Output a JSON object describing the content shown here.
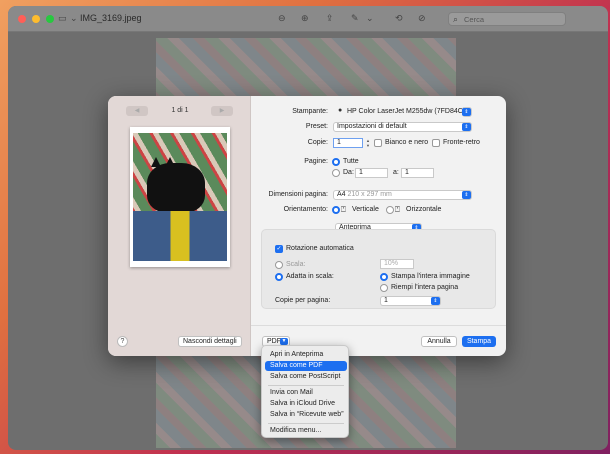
{
  "window": {
    "title": "IMG_3169.jpeg",
    "search_placeholder": "Cerca"
  },
  "preview": {
    "page_indicator": "1 di 1",
    "prev_label": "◀",
    "next_label": "▶"
  },
  "form": {
    "printer_label": "Stampante:",
    "printer_value": "HP Color LaserJet M255dw (7FD84C)",
    "preset_label": "Preset:",
    "preset_value": "Impostazioni di default",
    "copies_label": "Copie:",
    "copies_value": "1",
    "bw_label": "Bianco e nero",
    "duplex_label": "Fronte-retro",
    "pages_label": "Pagine:",
    "pages_all": "Tutte",
    "pages_from": "Da:",
    "pages_from_value": "1",
    "pages_to": "a:",
    "pages_to_value": "1",
    "paper_label": "Dimensioni pagina:",
    "paper_value": "A4",
    "paper_size": "210 x 297 mm",
    "orientation_label": "Orientamento:",
    "portrait": "Verticale",
    "landscape": "Orizzontale",
    "section_value": "Anteprima",
    "auto_rotate": "Rotazione automatica",
    "scale_label": "Scala:",
    "scale_value": "10%",
    "fit_label": "Adatta in scala:",
    "print_entire": "Stampa l'intera immagine",
    "fill_paper": "Riempi l'intera pagina",
    "copies_per_page_label": "Copie per pagina:",
    "copies_per_page_value": "1"
  },
  "footer": {
    "help": "?",
    "hide_details": "Nascondi dettagli",
    "pdf": "PDF",
    "cancel": "Annulla",
    "print": "Stampa"
  },
  "pdf_menu": {
    "items": [
      "Apri in Anteprima",
      "Salva come PDF",
      "Salva come PostScript",
      "Invia con Mail",
      "Salva in iCloud Drive",
      "Salva in “Ricevute web”",
      "Modifica menu..."
    ]
  },
  "colors": {
    "accent": "#1d6ff0"
  }
}
